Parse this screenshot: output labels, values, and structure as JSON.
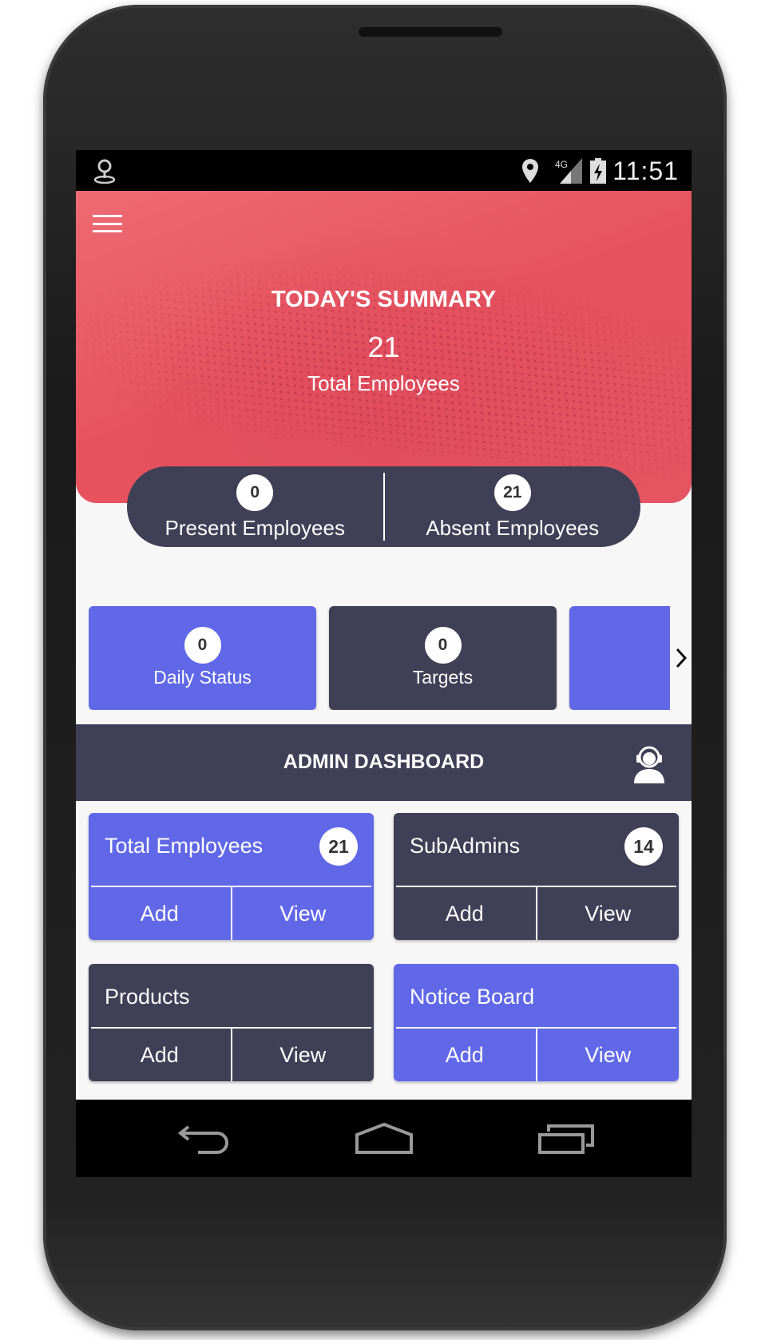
{
  "status_bar": {
    "time": "11:51",
    "network": "4G"
  },
  "hero": {
    "title": "TODAY'S SUMMARY",
    "total_value": "21",
    "total_label": "Total Employees"
  },
  "attendance": {
    "present": {
      "count": "0",
      "label": "Present Employees"
    },
    "absent": {
      "count": "21",
      "label": "Absent Employees"
    }
  },
  "cards": [
    {
      "count": "0",
      "label": "Daily Status",
      "color": "#6068e8"
    },
    {
      "count": "0",
      "label": "Targets",
      "color": "#3f3f56"
    }
  ],
  "admin": {
    "title": "ADMIN DASHBOARD",
    "tiles": [
      {
        "title": "Total Employees",
        "count": "21",
        "add": "Add",
        "view": "View"
      },
      {
        "title": "SubAdmins",
        "count": "14",
        "add": "Add",
        "view": "View"
      },
      {
        "title": "Products",
        "add": "Add",
        "view": "View"
      },
      {
        "title": "Notice Board",
        "add": "Add",
        "view": "View"
      }
    ]
  },
  "colors": {
    "accent_red": "#e6525e",
    "dark": "#3f3f56",
    "purple": "#6068e8"
  }
}
